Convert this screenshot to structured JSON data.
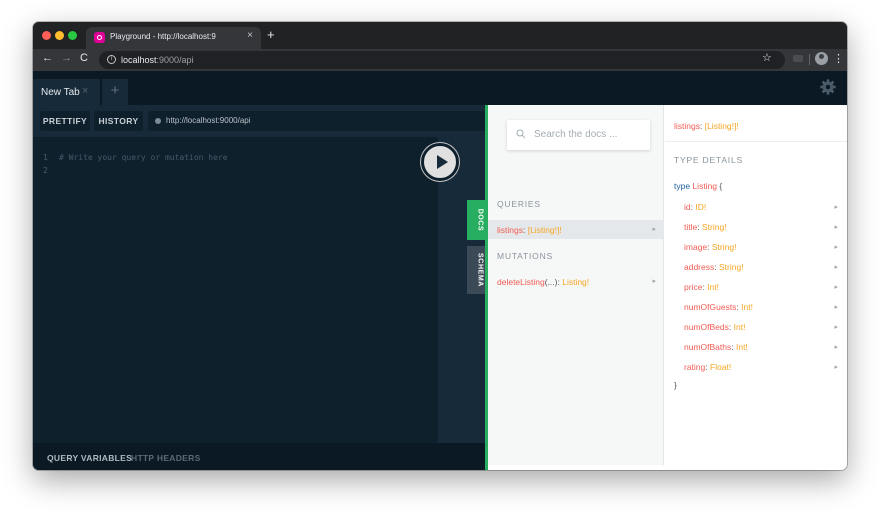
{
  "browser": {
    "tab_title": "Playground - http://localhost:9",
    "tab_close": "×",
    "new_tab": "+",
    "back": "←",
    "forward": "→",
    "reload": "C",
    "url_host": "localhost",
    "url_rest": ":9000/api",
    "star": "☆",
    "menu": "⋮"
  },
  "playground": {
    "tab_label": "New Tab",
    "tab_close": "×",
    "add_tab": "+",
    "prettify": "PRETTIFY",
    "history": "HISTORY",
    "endpoint": "http://localhost:9000/api",
    "line_numbers": [
      "1",
      "2"
    ],
    "editor_comment": "# Write your query or mutation here",
    "side_tabs": {
      "docs": "DOCS",
      "schema": "SCHEMA"
    },
    "bottom": {
      "query_variables": "QUERY VARIABLES",
      "http_headers": "HTTP HEADERS"
    }
  },
  "docs": {
    "search_placeholder": "Search the docs ...",
    "queries_label": "QUERIES",
    "mutations_label": "MUTATIONS",
    "queries": [
      {
        "name": "listings",
        "sep": ": ",
        "type": "[Listing!]!"
      }
    ],
    "mutations": [
      {
        "name": "deleteListing",
        "args": "(...)",
        "sep": ": ",
        "type": "Listing!"
      }
    ],
    "arrow": "▸",
    "detail_title": {
      "name": "listings",
      "sep": ": ",
      "type": "[Listing!]!"
    },
    "type_details_label": "TYPE DETAILS",
    "type_keyword": "type",
    "type_name": "Listing",
    "open_brace": "{",
    "close_brace": "}",
    "fields": [
      {
        "name": "id",
        "type": "ID!"
      },
      {
        "name": "title",
        "type": "String!"
      },
      {
        "name": "image",
        "type": "String!"
      },
      {
        "name": "address",
        "type": "String!"
      },
      {
        "name": "price",
        "type": "Int!"
      },
      {
        "name": "numOfGuests",
        "type": "Int!"
      },
      {
        "name": "numOfBeds",
        "type": "Int!"
      },
      {
        "name": "numOfBaths",
        "type": "Int!"
      },
      {
        "name": "rating",
        "type": "Float!"
      }
    ]
  },
  "colors": {
    "accent_green": "#27ae60",
    "field_red": "#f25c54",
    "type_orange": "#f5a623",
    "editor_bg": "#0f202d"
  }
}
